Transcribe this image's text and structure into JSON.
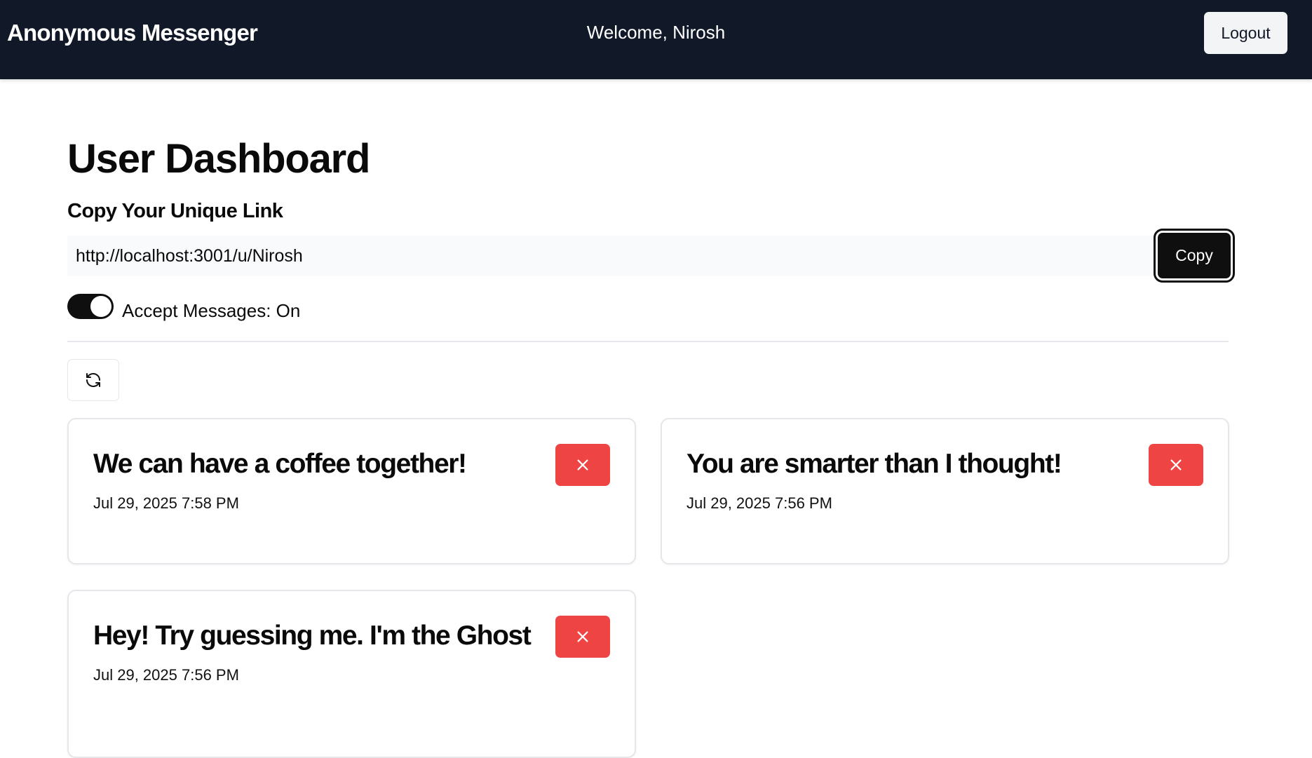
{
  "navbar": {
    "brand": "Anonymous Messenger",
    "welcome": "Welcome, Nirosh",
    "logout_label": "Logout"
  },
  "dashboard": {
    "title": "User Dashboard",
    "link_section_label": "Copy Your Unique Link",
    "unique_link": "http://localhost:3001/u/Nirosh",
    "copy_label": "Copy",
    "accept_messages_label": "Accept Messages: On",
    "accept_messages_on": true,
    "refresh_icon": "refresh-icon"
  },
  "messages": [
    {
      "content": "We can have a coffee together!",
      "created_at": "Jul 29, 2025 7:58 PM"
    },
    {
      "content": "You are smarter than I thought!",
      "created_at": "Jul 29, 2025 7:56 PM"
    },
    {
      "content": "Hey! Try guessing me. I'm the Ghost",
      "created_at": "Jul 29, 2025 7:56 PM"
    }
  ],
  "colors": {
    "navbar_bg": "#111827",
    "delete_button": "#ef4444",
    "primary_button": "#0f0f0f"
  }
}
